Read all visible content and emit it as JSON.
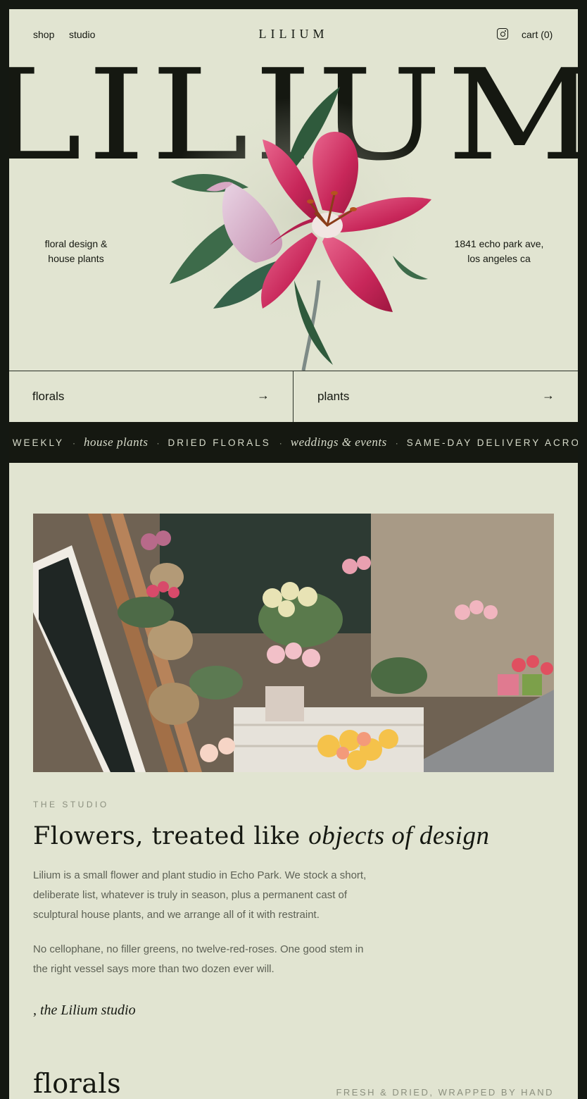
{
  "nav": {
    "shop": "shop",
    "studio": "studio",
    "logo": "LILIUM",
    "instagram_icon": "instagram-icon",
    "cart": "cart (0)"
  },
  "hero": {
    "word": "LILIUM",
    "left_line1": "floral design &",
    "left_line2": "house plants",
    "right_line1": "1841 echo park ave,",
    "right_line2": "los angeles ca"
  },
  "categories": [
    {
      "label": "florals",
      "arrow": "→"
    },
    {
      "label": "plants",
      "arrow": "→"
    }
  ],
  "marquee": [
    {
      "text": "S WEEKLY",
      "style": "caps"
    },
    {
      "text": "house plants",
      "style": "italic"
    },
    {
      "text": "DRIED FLORALS",
      "style": "caps"
    },
    {
      "text": "weddings & events",
      "style": "italic"
    },
    {
      "text": "SAME-DAY DELIVERY ACROSS",
      "style": "caps"
    }
  ],
  "marquee_separator": "·",
  "studio": {
    "eyebrow": "THE STUDIO",
    "headline_plain": "Flowers, treated like ",
    "headline_italic": "objects of design",
    "paragraph1": "Lilium is a small flower and plant studio in Echo Park. We stock a short, deliberate list, whatever is truly in season, plus a permanent cast of sculptural house plants, and we arrange all of it with restraint.",
    "paragraph2": "No cellophane, no filler greens, no twelve-red-roses. One good stem in the right vessel says more than two dozen ever will.",
    "signature": ", the Lilium studio"
  },
  "florals_section": {
    "title": "florals",
    "tagline": "FRESH & DRIED, WRAPPED BY HAND"
  },
  "colors": {
    "page_bg": "#e1e4d1",
    "frame": "#141812",
    "ink": "#151811",
    "muted": "#8b8f7e",
    "lily_pink": "#c8275a",
    "leaf_green": "#3d6b4a"
  }
}
